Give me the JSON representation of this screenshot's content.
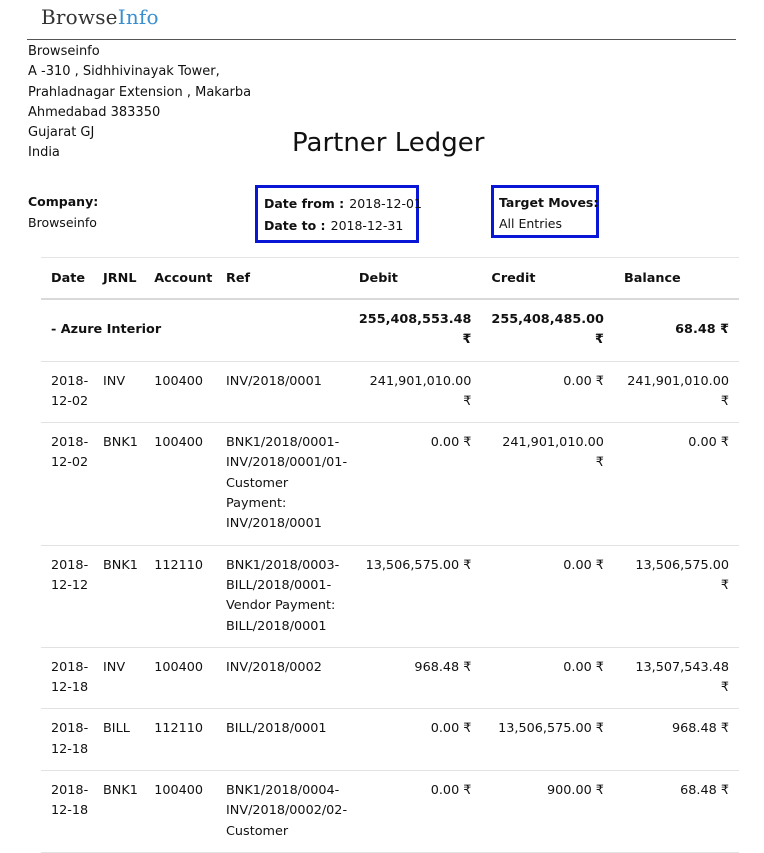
{
  "header": {
    "logo_main": "Browse",
    "logo_accent": "Info"
  },
  "address": {
    "lines": [
      "Browseinfo",
      "A -310 , Sidhhivinayak Tower,",
      "Prahladnagar Extension , Makarba",
      "Ahmedabad 383350",
      "Gujarat GJ",
      "India"
    ]
  },
  "report": {
    "title": "Partner Ledger",
    "company_label": "Company:",
    "company_value": "Browseinfo",
    "date_from_label": "Date from :",
    "date_from_value": "2018-12-01",
    "date_to_label": "Date to :",
    "date_to_value": "2018-12-31",
    "target_moves_label": "Target Moves:",
    "target_moves_value": "All Entries"
  },
  "table": {
    "headers": [
      "Date",
      "JRNL",
      "Account",
      "Ref",
      "Debit",
      "Credit",
      "Balance"
    ],
    "partner_row": {
      "name": "- Azure Interior",
      "debit": "255,408,553.48 ₹",
      "credit": "255,408,485.00 ₹",
      "balance": "68.48 ₹"
    },
    "rows": [
      {
        "date": [
          "2018-",
          "12-02"
        ],
        "jrnl": "INV",
        "account": "100400",
        "ref": [
          "INV/2018/0001"
        ],
        "debit": "241,901,010.00 ₹",
        "credit": "0.00 ₹",
        "balance": "241,901,010.00 ₹"
      },
      {
        "date": [
          "2018-",
          "12-02"
        ],
        "jrnl": "BNK1",
        "account": "100400",
        "ref": [
          "BNK1/2018/0001-",
          "INV/2018/0001/01-",
          "Customer",
          "Payment:",
          "INV/2018/0001"
        ],
        "debit": "0.00 ₹",
        "credit": "241,901,010.00 ₹",
        "balance": "0.00 ₹"
      },
      {
        "date": [
          "2018-",
          "12-12"
        ],
        "jrnl": "BNK1",
        "account": "112110",
        "ref": [
          "BNK1/2018/0003-",
          "BILL/2018/0001-",
          "Vendor Payment:",
          "BILL/2018/0001"
        ],
        "debit": "13,506,575.00 ₹",
        "credit": "0.00 ₹",
        "balance": "13,506,575.00 ₹"
      },
      {
        "date": [
          "2018-",
          "12-18"
        ],
        "jrnl": "INV",
        "account": "100400",
        "ref": [
          "INV/2018/0002"
        ],
        "debit": "968.48 ₹",
        "credit": "0.00 ₹",
        "balance": "13,507,543.48 ₹"
      },
      {
        "date": [
          "2018-",
          "12-18"
        ],
        "jrnl": "BILL",
        "account": "112110",
        "ref": [
          "BILL/2018/0001"
        ],
        "debit": "0.00 ₹",
        "credit": "13,506,575.00 ₹",
        "balance": "968.48 ₹"
      },
      {
        "date": [
          "2018-",
          "12-18"
        ],
        "jrnl": "BNK1",
        "account": "100400",
        "ref": [
          "BNK1/2018/0004-",
          "INV/2018/0002/02-",
          "Customer"
        ],
        "debit": "0.00 ₹",
        "credit": "900.00 ₹",
        "balance": "68.48 ₹"
      }
    ]
  }
}
